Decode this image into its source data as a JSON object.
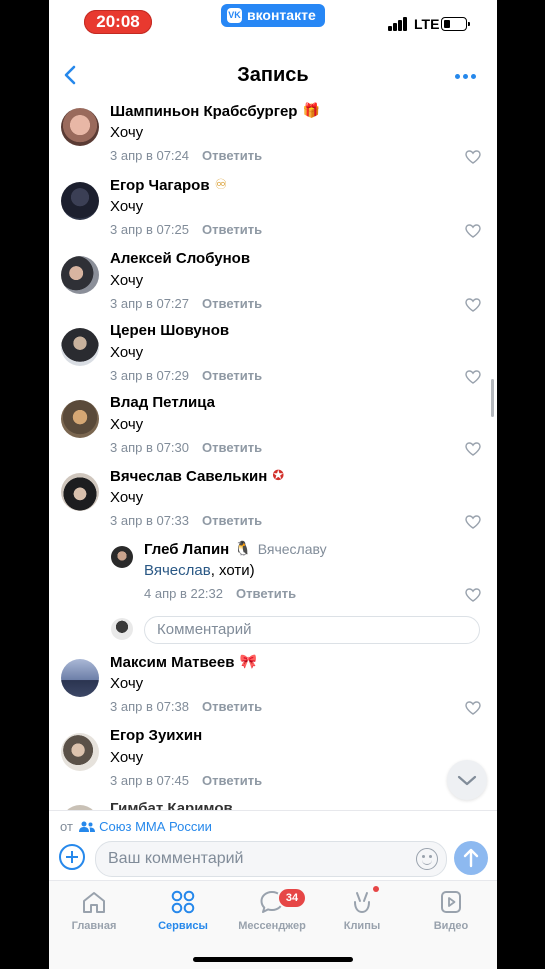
{
  "status_bar": {
    "time": "20:08",
    "app": "вконтакте",
    "app_logo": "vk",
    "network": "LTE",
    "battery_percent": 25
  },
  "header": {
    "title": "Запись",
    "back_icon": "chevron-left-icon",
    "menu_icon": "more-dots-icon"
  },
  "comments": [
    {
      "name": "Шампиньон Крабсбургер",
      "badge": "🎁",
      "text": "Хочу",
      "date": "3 апр в 07:24",
      "reply_label": "Ответить"
    },
    {
      "name": "Егор Чагаров",
      "badge": "♾",
      "text": "Хочу",
      "date": "3 апр в 07:25",
      "reply_label": "Ответить"
    },
    {
      "name": "Алексей Слобунов",
      "badge": "",
      "text": "Хочу",
      "date": "3 апр в 07:27",
      "reply_label": "Ответить"
    },
    {
      "name": "Церен Шовунов",
      "badge": "",
      "text": "Хочу",
      "date": "3 апр в 07:29",
      "reply_label": "Ответить"
    },
    {
      "name": "Влад Петлица",
      "badge": "",
      "text": "Хочу",
      "date": "3 апр в 07:30",
      "reply_label": "Ответить"
    },
    {
      "name": "Вячеслав Савелькин",
      "badge": "✪",
      "text": "Хочу",
      "date": "3 апр в 07:33",
      "reply_label": "Ответить"
    },
    {
      "name": "Максим Матвеев",
      "badge": "🎀",
      "text": "Хочу",
      "date": "3 апр в 07:38",
      "reply_label": "Ответить"
    },
    {
      "name": "Егор Зуихин",
      "badge": "",
      "text": "Хочу",
      "date": "3 апр в 07:45",
      "reply_label": "Ответить"
    }
  ],
  "reply": {
    "name": "Глеб Лапин",
    "badge": "🐧",
    "reply_to": "Вячеславу",
    "mention": "Вячеслав",
    "text": ", хоти)",
    "date": "4 апр в 22:32",
    "reply_label": "Ответить"
  },
  "reply_input": {
    "placeholder": "Комментарий"
  },
  "partial_next_name": "Гимбат Каримов",
  "compose": {
    "from_prefix": "от",
    "from_group": "Союз ММА России",
    "placeholder": "Ваш комментарий"
  },
  "tabbar": {
    "items": [
      {
        "label": "Главная",
        "icon": "home-icon"
      },
      {
        "label": "Сервисы",
        "icon": "services-grid-icon"
      },
      {
        "label": "Мессенджер",
        "icon": "chat-icon",
        "badge": "34"
      },
      {
        "label": "Клипы",
        "icon": "clips-icon"
      },
      {
        "label": "Видео",
        "icon": "video-icon"
      }
    ],
    "active": "Сервисы"
  },
  "colors": {
    "accent": "#2688eb",
    "badge": "#e64646",
    "time_pill": "#e8392f",
    "vk_blue": "#2787f5"
  }
}
